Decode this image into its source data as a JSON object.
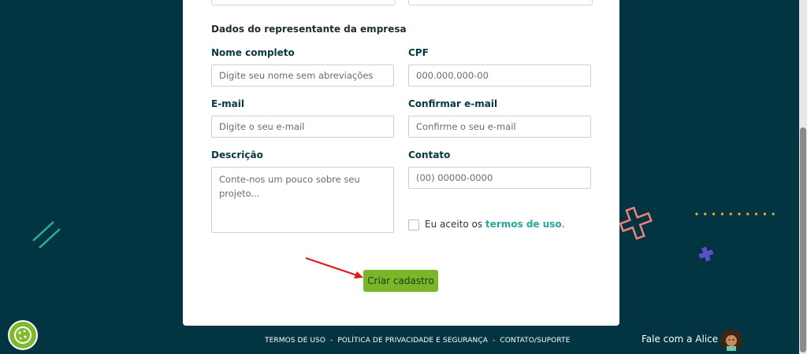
{
  "form": {
    "section_title": "Dados do representante da empresa",
    "fields": {
      "nome": {
        "label": "Nome completo",
        "placeholder": "Digite seu nome sem abreviações"
      },
      "cpf": {
        "label": "CPF",
        "placeholder": "000.000.000-00"
      },
      "email": {
        "label": "E-mail",
        "placeholder": "Digite o seu e-mail"
      },
      "confirm_email": {
        "label": "Confirmar e-mail",
        "placeholder": "Confirme o seu e-mail"
      },
      "descricao": {
        "label": "Descrição",
        "placeholder": "Conte-nos um pouco sobre seu projeto..."
      },
      "contato": {
        "label": "Contato",
        "placeholder": "(00) 00000-0000"
      }
    },
    "terms": {
      "prefix": "Eu aceito os ",
      "link": "termos de uso",
      "suffix": "."
    },
    "submit_label": "Criar cadastro"
  },
  "footer": {
    "links": [
      "TERMOS DE USO",
      "POLÍTICA DE PRIVACIDADE E SEGURANÇA",
      "CONTATO/SUPORTE"
    ],
    "separator": "-"
  },
  "chat": {
    "label": "Fale com a Alice"
  },
  "colors": {
    "background": "#023442",
    "accent_green": "#7ab62a",
    "link_teal": "#23a996",
    "decor_cross_pink": "#f07f7b",
    "decor_cross_purple": "#5b4fc7",
    "decor_dots_yellow": "#f2b21d",
    "annotation_arrow": "#e5141a"
  },
  "icons": [
    "cookie-settings-icon",
    "chat-avatar-icon",
    "checkbox-icon"
  ]
}
